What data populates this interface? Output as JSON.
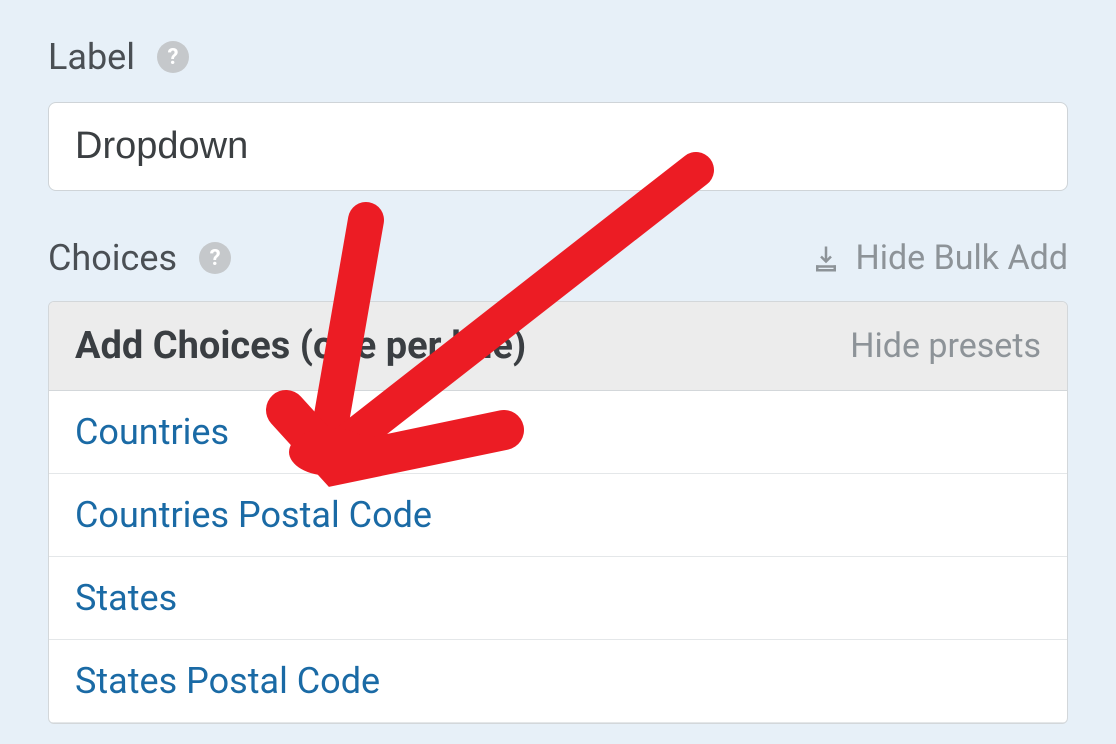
{
  "label_section": {
    "title": "Label",
    "input_value": "Dropdown"
  },
  "choices_section": {
    "title": "Choices",
    "hide_bulk_label": "Hide Bulk Add",
    "panel_title": "Add Choices (one per line)",
    "hide_presets_label": "Hide presets",
    "presets": [
      "Countries",
      "Countries Postal Code",
      "States",
      "States Postal Code"
    ]
  },
  "annotation": {
    "type": "red-arrow",
    "target": "preset-countries"
  }
}
